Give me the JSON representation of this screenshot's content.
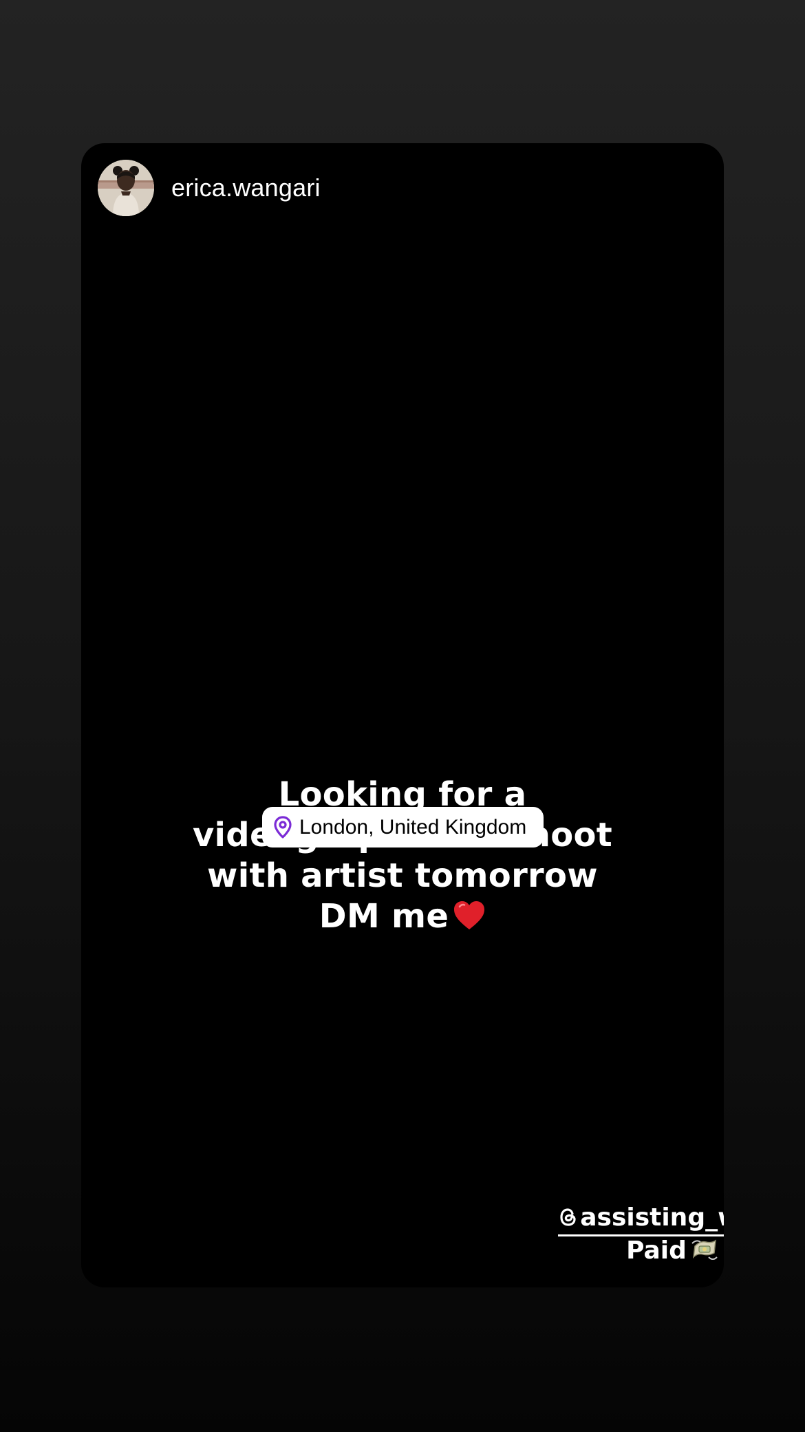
{
  "story": {
    "username": "erica.wangari",
    "caption_lines": [
      "Looking for a",
      "videographer to shoot",
      "with artist tomorrow",
      "DM me"
    ],
    "location": "London, United Kingdom",
    "mention": "assisting_work",
    "footer_text": "Paid"
  },
  "icons": {
    "avatar": "profile-photo",
    "caption_emoji": "red-heart-icon",
    "location": "location-pin-icon",
    "mention": "threads-logo-icon",
    "footer_emoji": "money-with-wings-icon"
  },
  "colors": {
    "background_top": "#232323",
    "background_bottom": "#050505",
    "card": "#000000",
    "text": "#ffffff",
    "pin": "#7b2bd6",
    "heart": "#e0202a"
  }
}
